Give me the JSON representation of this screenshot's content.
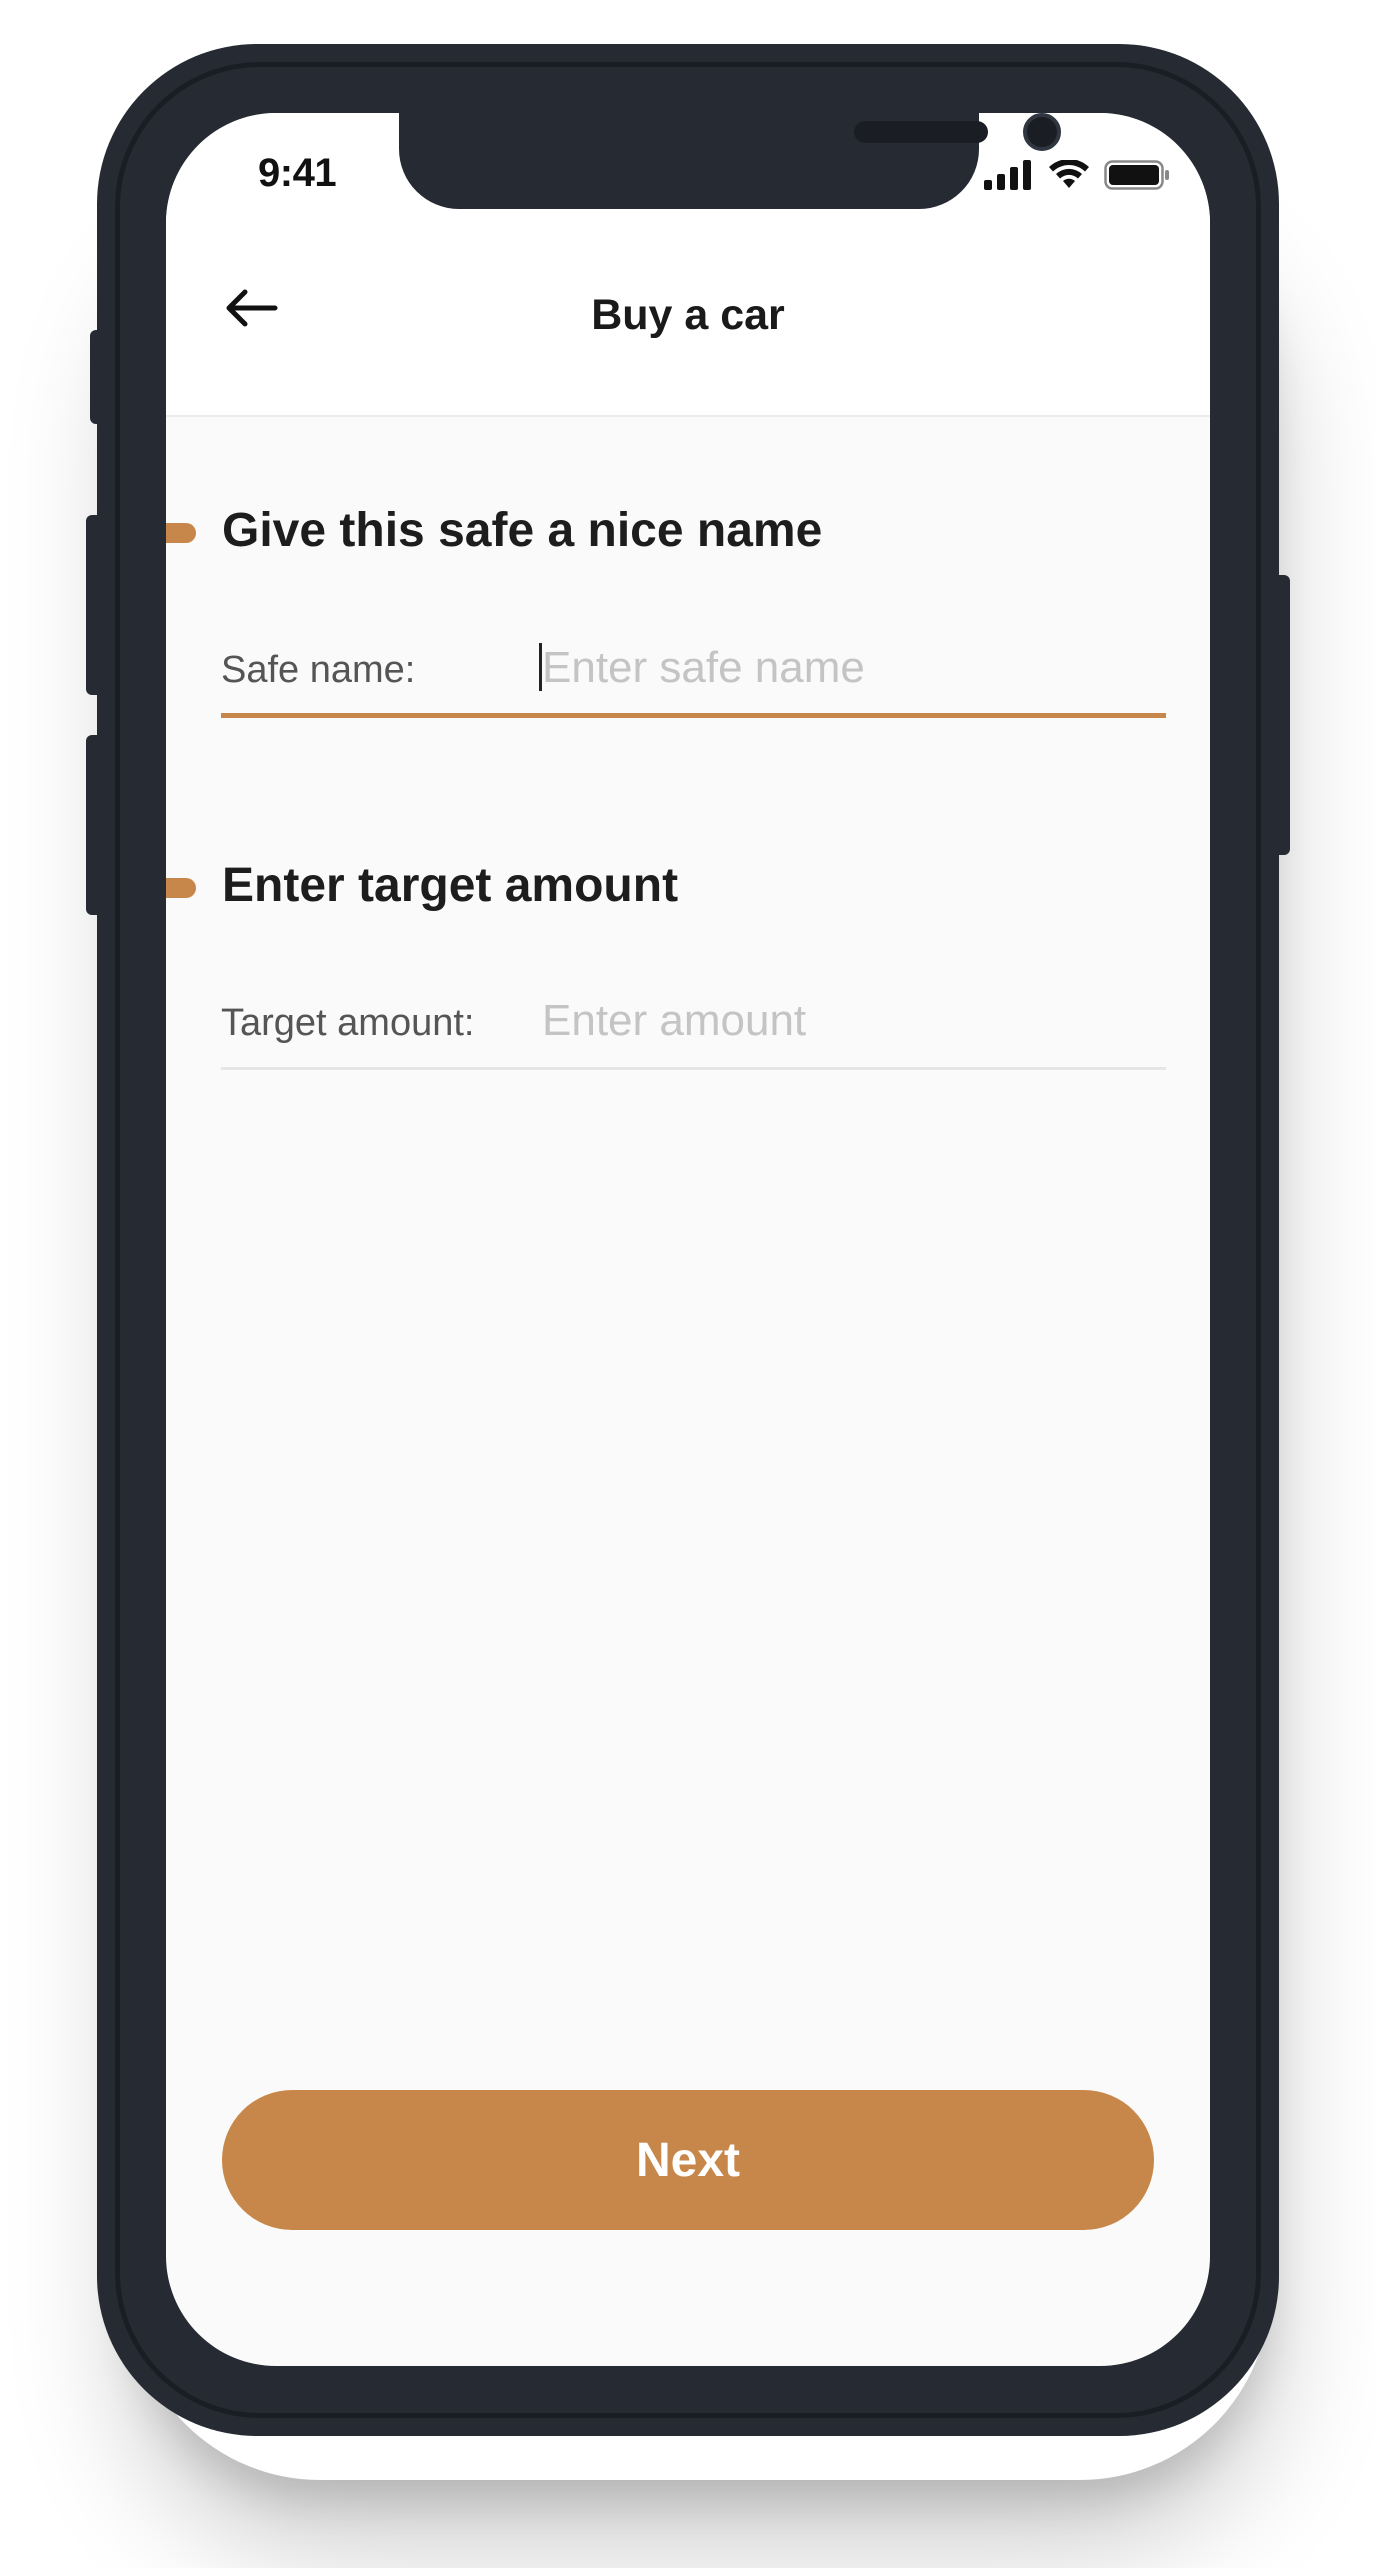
{
  "status_bar": {
    "time": "9:41",
    "icons": [
      "cellular-signal-icon",
      "wifi-icon",
      "battery-icon"
    ]
  },
  "header": {
    "back_icon": "arrow-left-icon",
    "title": "Buy a car"
  },
  "sections": [
    {
      "heading": "Give this safe a nice name",
      "field_label": "Safe name:",
      "field_value": "",
      "field_placeholder": "Enter safe name",
      "focused": true
    },
    {
      "heading": "Enter target amount",
      "field_label": "Target amount:",
      "field_value": "",
      "field_placeholder": "Enter amount",
      "focused": false
    }
  ],
  "actions": {
    "next_label": "Next"
  },
  "colors": {
    "accent": "#c8874a",
    "phone_frame": "#262b33",
    "screen_background": "#fafafa",
    "header_background": "#ffffff",
    "placeholder_text": "#c4c4c4",
    "label_text": "#555555"
  }
}
